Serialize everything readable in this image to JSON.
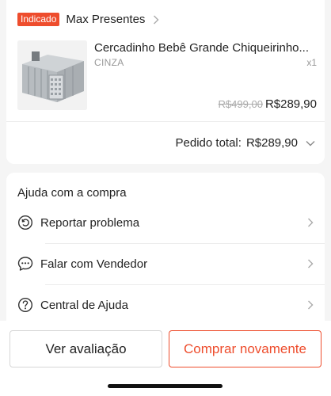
{
  "order": {
    "badge": "Indicado",
    "store_name": "Max Presentes",
    "product_title": "Cercadinho Bebê Grande Chiqueirinho...",
    "variant": "CINZA",
    "quantity": "x1",
    "old_price": "R$499,00",
    "price": "R$289,90",
    "total_label": "Pedido total:",
    "total_value": "R$289,90"
  },
  "help": {
    "title": "Ajuda com a compra",
    "items": [
      {
        "label": "Reportar problema",
        "icon": "report-problem-icon"
      },
      {
        "label": "Falar com Vendedor",
        "icon": "chat-icon"
      },
      {
        "label": "Central de Ajuda",
        "icon": "help-center-icon"
      }
    ]
  },
  "actions": {
    "review_label": "Ver avaliação",
    "buy_again_label": "Comprar novamente"
  },
  "colors": {
    "accent": "#ee4d2d",
    "text": "#222222",
    "muted": "#999999"
  }
}
